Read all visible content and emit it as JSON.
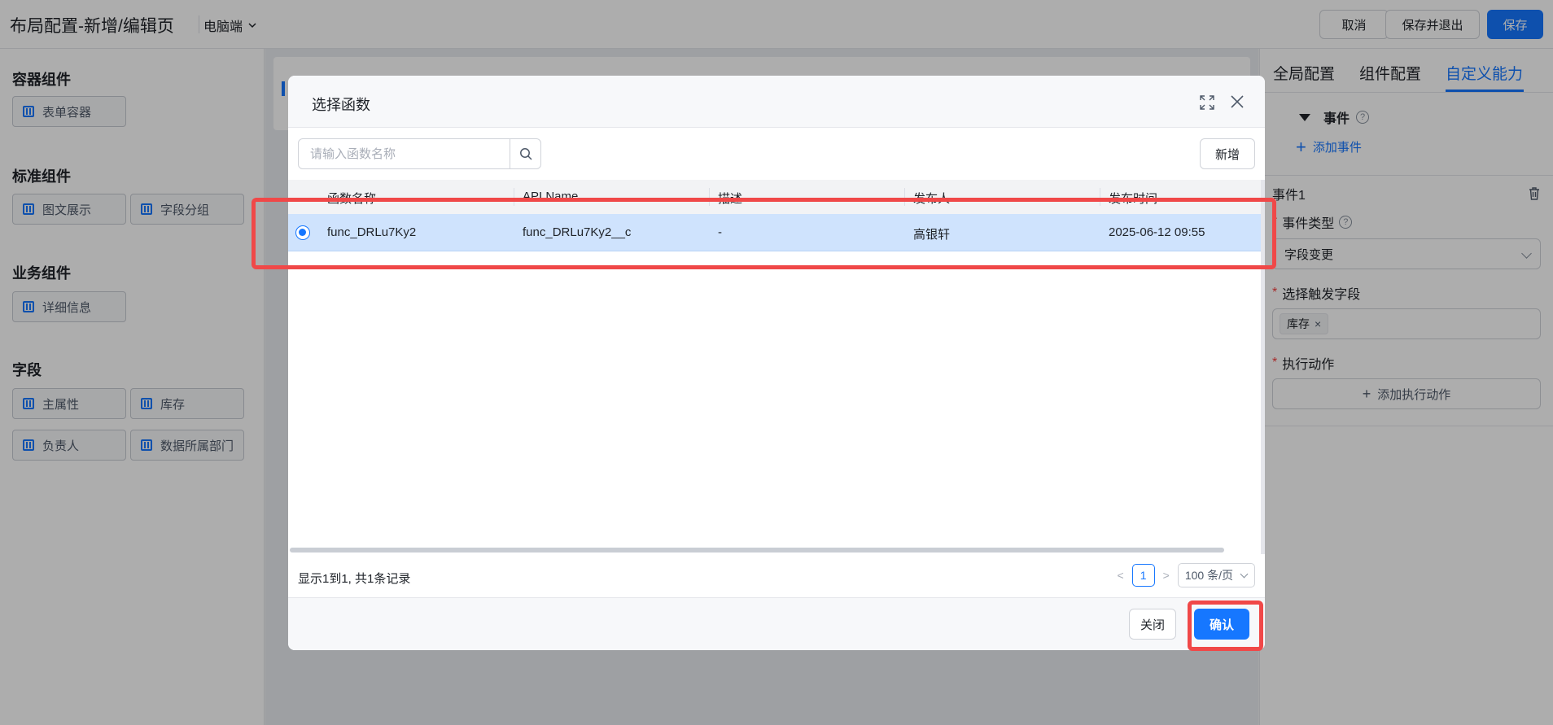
{
  "header": {
    "title": "布局配置-新增/编辑页",
    "device": "电脑端",
    "cancel": "取消",
    "save_exit": "保存并退出",
    "save": "保存"
  },
  "left": {
    "groups": [
      {
        "title": "容器组件",
        "items": [
          "表单容器"
        ]
      },
      {
        "title": "标准组件",
        "items": [
          "图文展示",
          "字段分组"
        ]
      },
      {
        "title": "业务组件",
        "items": [
          "详细信息"
        ]
      },
      {
        "title": "字段",
        "items": [
          "主属性",
          "库存",
          "负责人",
          "数据所属部门"
        ]
      }
    ]
  },
  "right": {
    "tabs": [
      "全局配置",
      "组件配置",
      "自定义能力"
    ],
    "active_tab": "自定义能力",
    "event_section": "事件",
    "add_event": "添加事件",
    "event_name": "事件1",
    "event_type_label": "事件类型",
    "event_type_value": "字段变更",
    "trigger_label": "选择触发字段",
    "trigger_tag": "库存",
    "action_label": "执行动作",
    "add_action": "添加执行动作"
  },
  "modal": {
    "title": "选择函数",
    "search_placeholder": "请输入函数名称",
    "new_button": "新增",
    "columns": [
      "函数名称",
      "API Name",
      "描述",
      "发布人",
      "发布时间"
    ],
    "rows": [
      {
        "name": "func_DRLu7Ky2",
        "api_name": "func_DRLu7Ky2__c",
        "desc": "-",
        "publisher": "高银轩",
        "time": "2025-06-12 09:55",
        "selected": true
      }
    ],
    "record_info": "显示1到1, 共1条记录",
    "page": "1",
    "page_size": "100 条/页",
    "close_button": "关闭",
    "confirm_button": "确认"
  },
  "colors": {
    "accent": "#1677ff",
    "highlight": "#f04848",
    "selected_row": "#cfe3fd"
  }
}
